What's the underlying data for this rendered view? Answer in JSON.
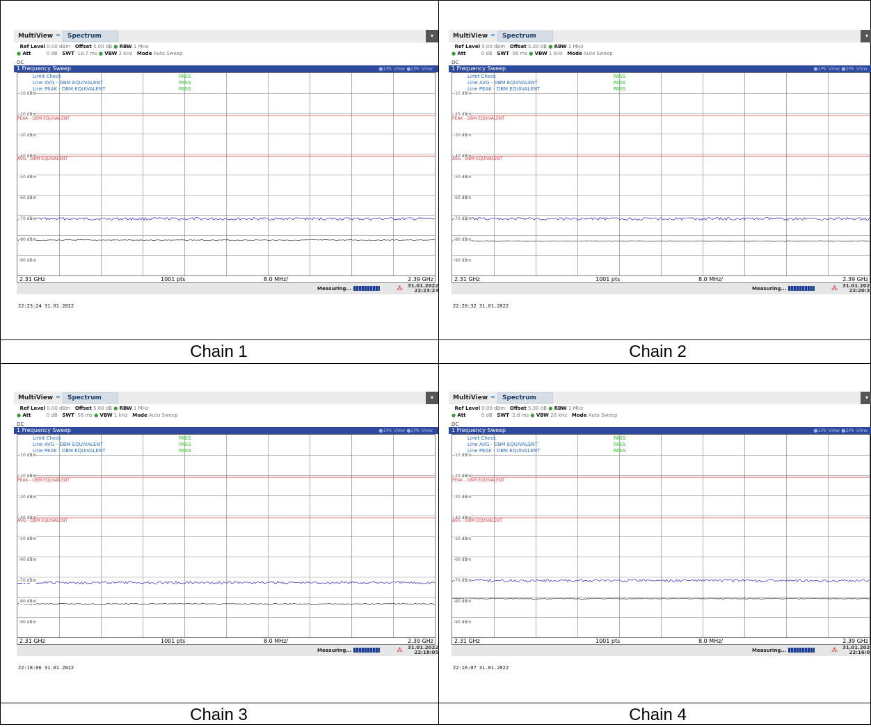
{
  "panels": [
    {
      "caption": "Chain 1",
      "app_title": "MultiView",
      "tab": "Spectrum",
      "ref_level_label": "Ref Level",
      "ref_level": "0.00 dBm",
      "offset_label": "Offset",
      "offset": "5.00 dB",
      "rbw_label": "RBW",
      "rbw": "1 MHz",
      "att_label": "Att",
      "att": "0 dB",
      "swt_label": "SWT",
      "swt": "18.7 ms",
      "vbw_label": "VBW",
      "vbw": "3 kHz",
      "mode_label": "Mode",
      "mode": "Auto Sweep",
      "dc": "DC",
      "sweep_title": "1 Frequency Sweep",
      "views": "●1Pk View ●2Pk View",
      "limit_check": "Limit Check",
      "line_avg": "Line AVG - DBM EQUIVALENT",
      "line_peak": "Line PEAK - DBM EQUIVALENT",
      "pass1": "PASS",
      "pass2": "PASS",
      "pass3": "PASS",
      "peak_label": "PEAK - DBM EQUIVALENT",
      "avg_label": "AVG - DBM EQUIVALENT",
      "y_ticks": [
        "-10 dBm",
        "-20 dBm",
        "-30 dBm",
        "-40 dBm",
        "-50 dBm",
        "-60 dBm",
        "-70 dBm",
        "-80 dBm",
        "-90 dBm"
      ],
      "f_start": "2.31 GHz",
      "pts": "1001 pts",
      "span_step": "8.0 MHz/",
      "f_stop": "2.39 GHz",
      "measuring": "Measuring...",
      "status_date": "31.01.2022",
      "status_time": "22:23:23",
      "timestamp": "22:23:24  31.01.2022",
      "trace1_level_dbm": -72,
      "trace2_level_dbm": -82.5,
      "peak_limit_dbm": -21,
      "avg_limit_dbm": -41
    },
    {
      "caption": "Chain 2",
      "app_title": "MultiView",
      "tab": "Spectrum",
      "ref_level_label": "Ref Level",
      "ref_level": "0.00 dBm",
      "offset_label": "Offset",
      "offset": "5.00 dB",
      "rbw_label": "RBW",
      "rbw": "1 MHz",
      "att_label": "Att",
      "att": "0 dB",
      "swt_label": "SWT",
      "swt": "56 ms",
      "vbw_label": "VBW",
      "vbw": "1 kHz",
      "mode_label": "Mode",
      "mode": "Auto Sweep",
      "dc": "DC",
      "sweep_title": "1 Frequency Sweep",
      "views": "●1Pk View ●2Pk View",
      "limit_check": "Limit Check",
      "line_avg": "Line AVG - DBM EQUIVALENT",
      "line_peak": "Line PEAK - DBM EQUIVALENT",
      "pass1": "PASS",
      "pass2": "PASS",
      "pass3": "PASS",
      "peak_label": "PEAK - DBM EQUIVALENT",
      "avg_label": "AVG - DBM EQUIVALENT",
      "y_ticks": [
        "-10 dBm",
        "-20 dBm",
        "-30 dBm",
        "-40 dBm",
        "-50 dBm",
        "-60 dBm",
        "-70 dBm",
        "-80 dBm",
        "-90 dBm"
      ],
      "f_start": "2.31 GHz",
      "pts": "1001 pts",
      "span_step": "8.0 MHz/",
      "f_stop": "2.39 GHz",
      "measuring": "Measuring...",
      "status_date": "31.01.2022",
      "status_time": "22:20:31",
      "timestamp": "22:20:32  31.01.2022",
      "trace1_level_dbm": -72,
      "trace2_level_dbm": -83,
      "peak_limit_dbm": -21,
      "avg_limit_dbm": -41
    },
    {
      "caption": "Chain 3",
      "app_title": "MultiView",
      "tab": "Spectrum",
      "ref_level_label": "Ref Level",
      "ref_level": "0.00 dBm",
      "offset_label": "Offset",
      "offset": "5.00 dB",
      "rbw_label": "RBW",
      "rbw": "1 MHz",
      "att_label": "Att",
      "att": "0 dB",
      "swt_label": "SWT",
      "swt": "56 ms",
      "vbw_label": "VBW",
      "vbw": "1 kHz",
      "mode_label": "Mode",
      "mode": "Auto Sweep",
      "dc": "DC",
      "sweep_title": "1 Frequency Sweep",
      "views": "●1Pk View ●2Pk View",
      "limit_check": "Limit Check",
      "line_avg": "Line AVG - DBM EQUIVALENT",
      "line_peak": "Line PEAK - DBM EQUIVALENT",
      "pass1": "PASS",
      "pass2": "PASS",
      "pass3": "PASS",
      "peak_label": "PEAK - DBM EQUIVALENT",
      "avg_label": "AVG - DBM EQUIVALENT",
      "y_ticks": [
        "-10 dBm",
        "-20 dBm",
        "-30 dBm",
        "-40 dBm",
        "-50 dBm",
        "-60 dBm",
        "-70 dBm",
        "-80 dBm",
        "-90 dBm"
      ],
      "f_start": "2.31 GHz",
      "pts": "1001 pts",
      "span_step": "8.0 MHz/",
      "f_stop": "2.39 GHz",
      "measuring": "Measuring...",
      "status_date": "31.01.2022",
      "status_time": "22:18:05",
      "timestamp": "22:18:06  31.01.2022",
      "trace1_level_dbm": -73,
      "trace2_level_dbm": -83.5,
      "peak_limit_dbm": -21,
      "avg_limit_dbm": -41
    },
    {
      "caption": "Chain 4",
      "app_title": "MultiView",
      "tab": "Spectrum",
      "ref_level_label": "Ref Level",
      "ref_level": "0.00 dBm",
      "offset_label": "Offset",
      "offset": "5.00 dB",
      "rbw_label": "RBW",
      "rbw": "1 MHz",
      "att_label": "Att",
      "att": "0 dB",
      "swt_label": "SWT",
      "swt": "2.8 ms",
      "vbw_label": "VBW",
      "vbw": "20 kHz",
      "mode_label": "Mode",
      "mode": "Auto Sweep",
      "dc": "DC",
      "sweep_title": "1 Frequency Sweep",
      "views": "●1Pk View ●2Pk View",
      "limit_check": "Limit Check",
      "line_avg": "Line AVG - DBM EQUIVALENT",
      "line_peak": "Line PEAK - DBM EQUIVALENT",
      "pass1": "PASS",
      "pass2": "PASS",
      "pass3": "PASS",
      "peak_label": "PEAK - DBM EQUIVALENT",
      "avg_label": "AVG - DBM EQUIVALENT",
      "y_ticks": [
        "-10 dBm",
        "-20 dBm",
        "-30 dBm",
        "-40 dBm",
        "-50 dBm",
        "-60 dBm",
        "-70 dBm",
        "-80 dBm",
        "-90 dBm"
      ],
      "f_start": "2.31 GHz",
      "pts": "1001 pts",
      "span_step": "8.0 MHz/",
      "f_stop": "2.39 GHz",
      "measuring": "Measuring...",
      "status_date": "31.01.2022",
      "status_time": "22:16:07",
      "timestamp": "22:16:07  31.01.2022",
      "trace1_level_dbm": -72,
      "trace2_level_dbm": -81,
      "peak_limit_dbm": -21,
      "avg_limit_dbm": -41
    }
  ],
  "colors": {
    "trace1": "#2323c8",
    "trace2": "#333333",
    "limit": "#e04040",
    "pass": "#22c322",
    "sweep_bar": "#2e4a9f"
  }
}
